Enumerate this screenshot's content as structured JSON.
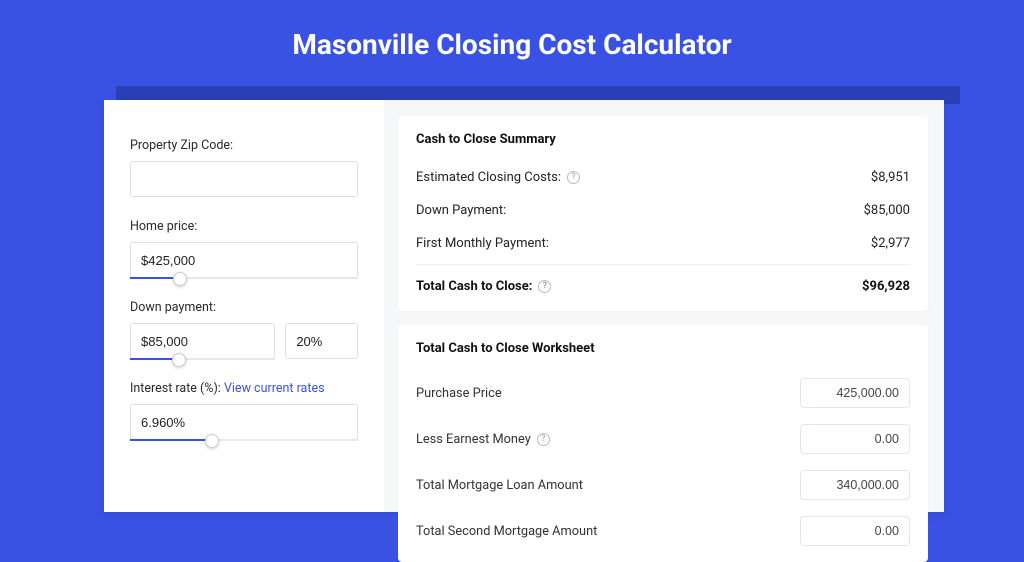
{
  "header": {
    "title": "Masonville Closing Cost Calculator"
  },
  "left": {
    "zip": {
      "label": "Property Zip Code:",
      "value": ""
    },
    "home_price": {
      "label": "Home price:",
      "value": "$425,000",
      "slider_pct": 22
    },
    "down_payment": {
      "label": "Down payment:",
      "value": "$85,000",
      "slider_pct": 34,
      "percent_value": "20%"
    },
    "interest": {
      "label": "Interest rate (%): ",
      "link_text": "View current rates",
      "value": "6.960%",
      "slider_pct": 36
    }
  },
  "summary": {
    "title": "Cash to Close Summary",
    "rows": [
      {
        "label": "Estimated Closing Costs:",
        "help": true,
        "value": "$8,951"
      },
      {
        "label": "Down Payment:",
        "help": false,
        "value": "$85,000"
      },
      {
        "label": "First Monthly Payment:",
        "help": false,
        "value": "$2,977"
      }
    ],
    "total": {
      "label": "Total Cash to Close:",
      "help": true,
      "value": "$96,928"
    }
  },
  "worksheet": {
    "title": "Total Cash to Close Worksheet",
    "rows": [
      {
        "label": "Purchase Price",
        "help": false,
        "value": "425,000.00"
      },
      {
        "label": "Less Earnest Money",
        "help": true,
        "value": "0.00"
      },
      {
        "label": "Total Mortgage Loan Amount",
        "help": false,
        "value": "340,000.00"
      },
      {
        "label": "Total Second Mortgage Amount",
        "help": false,
        "value": "0.00"
      }
    ]
  }
}
